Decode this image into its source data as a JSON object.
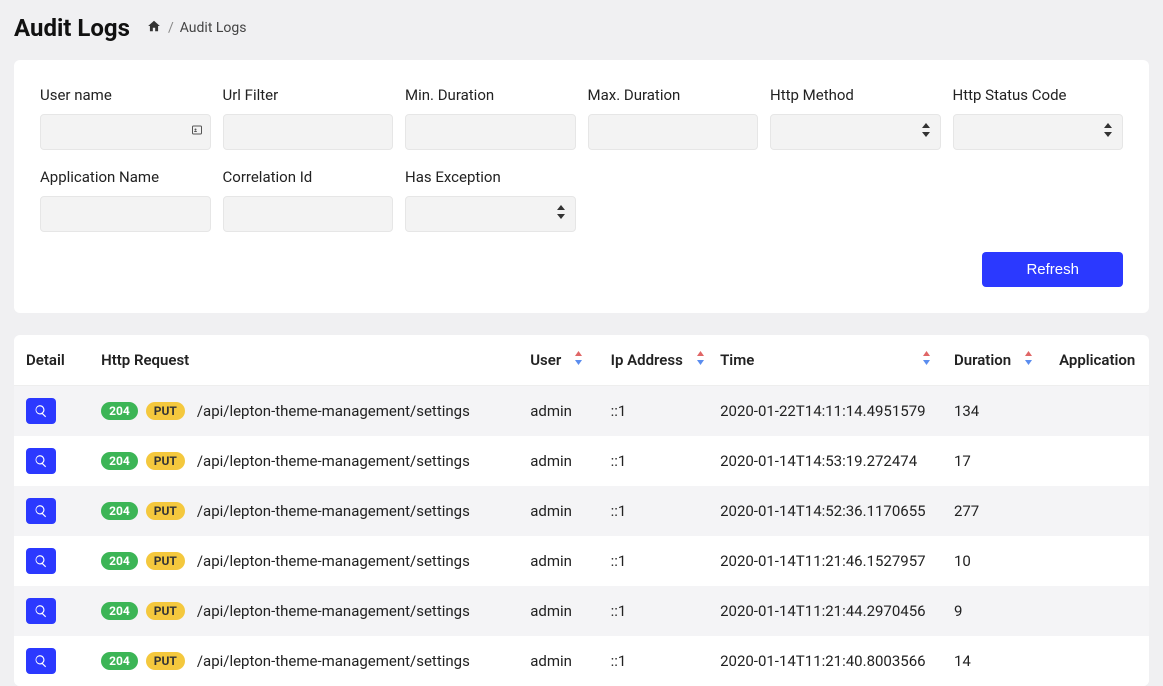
{
  "header": {
    "title": "Audit Logs",
    "breadcrumb_current": "Audit Logs"
  },
  "filters": {
    "username": {
      "label": "User name",
      "value": ""
    },
    "urlFilter": {
      "label": "Url Filter",
      "value": ""
    },
    "minDuration": {
      "label": "Min. Duration",
      "value": ""
    },
    "maxDuration": {
      "label": "Max. Duration",
      "value": ""
    },
    "httpMethod": {
      "label": "Http Method",
      "value": ""
    },
    "httpStatus": {
      "label": "Http Status Code",
      "value": ""
    },
    "appName": {
      "label": "Application Name",
      "value": ""
    },
    "correlationId": {
      "label": "Correlation Id",
      "value": ""
    },
    "hasException": {
      "label": "Has Exception",
      "value": ""
    }
  },
  "buttons": {
    "refresh": "Refresh"
  },
  "table": {
    "headers": {
      "detail": "Detail",
      "httpRequest": "Http Request",
      "user": "User",
      "ipAddress": "Ip Address",
      "time": "Time",
      "duration": "Duration",
      "application": "Application"
    },
    "rows": [
      {
        "status": "204",
        "method": "PUT",
        "url": "/api/lepton-theme-management/settings",
        "user": "admin",
        "ip": "::1",
        "time": "2020-01-22T14:11:14.4951579",
        "duration": "134",
        "app": ""
      },
      {
        "status": "204",
        "method": "PUT",
        "url": "/api/lepton-theme-management/settings",
        "user": "admin",
        "ip": "::1",
        "time": "2020-01-14T14:53:19.272474",
        "duration": "17",
        "app": ""
      },
      {
        "status": "204",
        "method": "PUT",
        "url": "/api/lepton-theme-management/settings",
        "user": "admin",
        "ip": "::1",
        "time": "2020-01-14T14:52:36.1170655",
        "duration": "277",
        "app": ""
      },
      {
        "status": "204",
        "method": "PUT",
        "url": "/api/lepton-theme-management/settings",
        "user": "admin",
        "ip": "::1",
        "time": "2020-01-14T11:21:46.1527957",
        "duration": "10",
        "app": ""
      },
      {
        "status": "204",
        "method": "PUT",
        "url": "/api/lepton-theme-management/settings",
        "user": "admin",
        "ip": "::1",
        "time": "2020-01-14T11:21:44.2970456",
        "duration": "9",
        "app": ""
      },
      {
        "status": "204",
        "method": "PUT",
        "url": "/api/lepton-theme-management/settings",
        "user": "admin",
        "ip": "::1",
        "time": "2020-01-14T11:21:40.8003566",
        "duration": "14",
        "app": ""
      }
    ]
  }
}
